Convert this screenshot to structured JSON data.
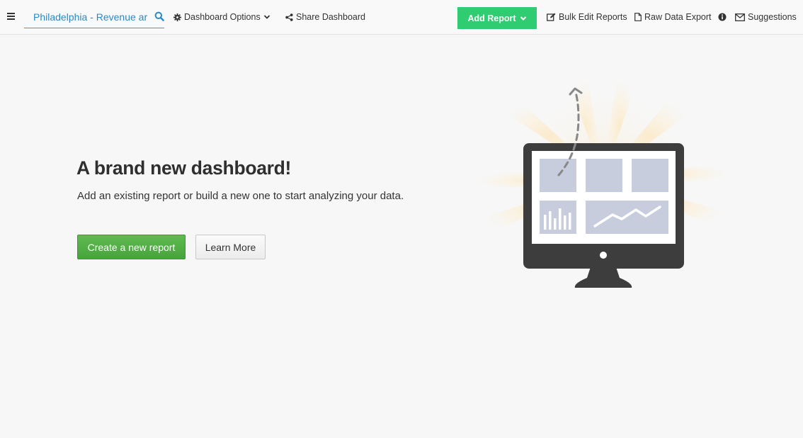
{
  "toolbar": {
    "search": {
      "value": "Philadelphia - Revenue ar",
      "placeholder": ""
    },
    "dashboard_options_label": "Dashboard Options",
    "share_label": "Share Dashboard",
    "add_report_label": "Add Report",
    "bulk_edit_label": "Bulk Edit Reports",
    "raw_export_label": "Raw Data Export",
    "suggestions_label": "Suggestions"
  },
  "main": {
    "title": "A brand new dashboard!",
    "subtitle": "Add an existing report or build a new one to start analyzing your data.",
    "create_button_label": "Create a new report",
    "learn_button_label": "Learn More"
  },
  "colors": {
    "accent_blue": "#3a9bd9",
    "add_report_green": "#2fcc71",
    "create_button_green": "#4fae43",
    "monitor_dark": "#3d3d3d",
    "tile_blue": "#c7cddd"
  }
}
